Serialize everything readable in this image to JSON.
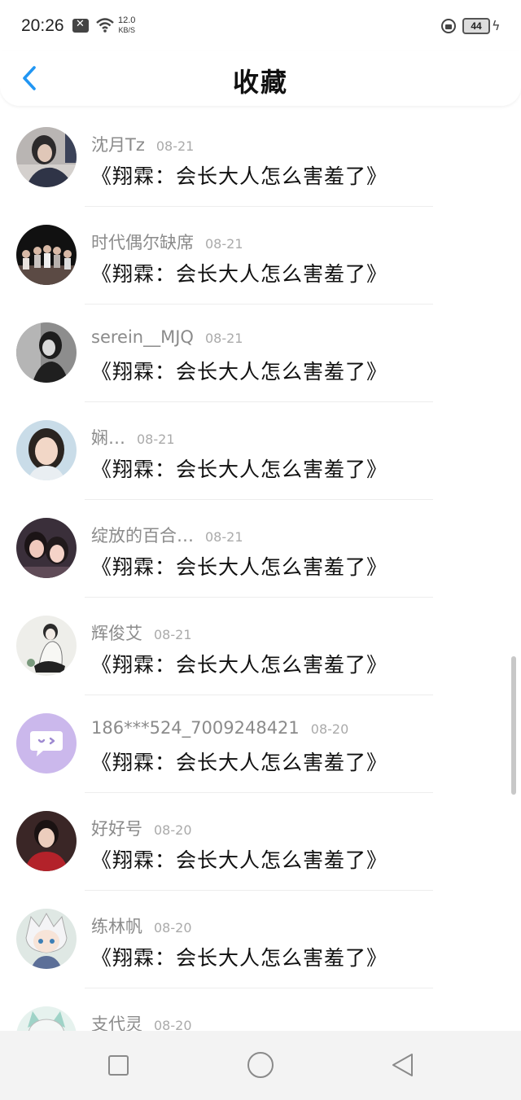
{
  "status_bar": {
    "time": "20:26",
    "net_speed_value": "12.0",
    "net_speed_unit": "KB/S",
    "battery_level": "44"
  },
  "header": {
    "title": "收藏"
  },
  "items": [
    {
      "username": "沈月Tz",
      "date": "08-21",
      "title": "《翔霖：会长大人怎么害羞了》",
      "avatar": "photo-girl-dark"
    },
    {
      "username": "时代偶尔缺席",
      "date": "08-21",
      "title": "《翔霖：会长大人怎么害羞了》",
      "avatar": "photo-group-stage"
    },
    {
      "username": "serein__MJQ",
      "date": "08-21",
      "title": "《翔霖：会长大人怎么害羞了》",
      "avatar": "photo-bw-girl"
    },
    {
      "username": "娴…",
      "date": "08-21",
      "title": "《翔霖：会长大人怎么害羞了》",
      "avatar": "photo-girl-selfie"
    },
    {
      "username": "绽放的百合…",
      "date": "08-21",
      "title": "《翔霖：会长大人怎么害羞了》",
      "avatar": "photo-two-girls"
    },
    {
      "username": "辉俊艾",
      "date": "08-21",
      "title": "《翔霖：会长大人怎么害羞了》",
      "avatar": "sketch-figure"
    },
    {
      "username": "186***524_7009248421",
      "date": "08-20",
      "title": "《翔霖：会长大人怎么害羞了》",
      "avatar": "default-bot"
    },
    {
      "username": "好好号",
      "date": "08-20",
      "title": "《翔霖：会长大人怎么害羞了》",
      "avatar": "photo-boy-red"
    },
    {
      "username": "练林帆",
      "date": "08-20",
      "title": "《翔霖：会长大人怎么害羞了》",
      "avatar": "anime-boy"
    },
    {
      "username": "支代灵",
      "date": "08-20",
      "title": "",
      "avatar": "anime-cat"
    }
  ],
  "colors": {
    "accent": "#2196f3",
    "username": "#8b8b8b",
    "date": "#aaaaaa",
    "title": "#111111",
    "avatar_default": "#cbb8ec"
  },
  "icons": {
    "back": "chevron-left-icon",
    "nav_recents": "square-icon",
    "nav_home": "circle-icon",
    "nav_back": "triangle-back-icon"
  }
}
